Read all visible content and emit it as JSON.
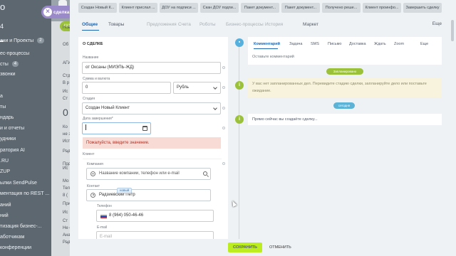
{
  "background": {
    "sidebar_logo": "o",
    "sidebar_num": "4",
    "sidebar_items": [
      {
        "label": "ачи и Проекты",
        "count": "2"
      },
      {
        "label": "ес-процессы",
        "count": ""
      },
      {
        "label": "сты",
        "count": "4"
      },
      {
        "label": "звонки",
        "count": ""
      },
      {
        "label": "а",
        "count": ""
      },
      {
        "label": "ты",
        "count": ""
      },
      {
        "label": "ндарь",
        "count": ""
      },
      {
        "label": "и и отчеты",
        "count": ""
      },
      {
        "label": "удники",
        "count": ""
      },
      {
        "label": "ратория AI",
        "count": ""
      },
      {
        "label": ".RU",
        "count": ""
      },
      {
        "label": "ZUP",
        "count": ""
      },
      {
        "label": "ылки SendPulse",
        "count": ""
      },
      {
        "label": "ментация по REST ...",
        "count": ""
      },
      {
        "label": "аний",
        "count": ""
      },
      {
        "label": "ний",
        "count": ""
      },
      {
        "label": "тизация бизнес-...",
        "count": ""
      },
      {
        "label": "аботчикам",
        "count": ""
      },
      {
        "label": "конференции",
        "count": ""
      }
    ],
    "board_pill": "АКЦ",
    "board_texts": [
      "Нов",
      "Об",
      "АГИ",
      "Стд",
      "В р",
      "Ис",
      "Ст",
      "Ко",
      "не з",
      "Ист",
      "Рад",
      "Прд",
      "Ис",
      "Мо",
      "Тел",
      "8 (",
      "При",
      "Ис",
      "Ст",
      "Не с",
      "Ана",
      "Рад"
    ],
    "board_big": "0"
  },
  "slider_label": "сделка",
  "stages": [
    "Создан Новый К...",
    "Клиент прислал ...",
    "ДОУ на подписи ...",
    "Скан ДОУ подпи...",
    "Пакет документ...",
    "Пакет документ...",
    "Получено реше...",
    "Клиент проинфо...",
    "Завершить сделку"
  ],
  "tabs": [
    {
      "label": "Общие",
      "state": "active"
    },
    {
      "label": "Товары",
      "state": "normal"
    },
    {
      "label": "Предложения",
      "state": "dim"
    },
    {
      "label": "Счета",
      "state": "dim"
    },
    {
      "label": "Роботы",
      "state": "dim"
    },
    {
      "label": "Бизнес-процессы",
      "state": "dim"
    },
    {
      "label": "История",
      "state": "dim"
    },
    {
      "label": "Маркет",
      "state": "normal"
    }
  ],
  "tabs_more": "Еще",
  "form": {
    "header": "О СДЕЛКЕ",
    "title_label": "Название",
    "title_value": "от Оксаны (МИЭПЬ-ЖД)",
    "sum_label": "Сумма и валюта",
    "sum_value": "0",
    "currency_value": "Рубль",
    "stage_label": "Стадия",
    "stage_value": "Создан Новый Клиент",
    "close_date_label": "Дата завершения*",
    "close_date_value": "",
    "error_text": "Пожалуйста, введите значение.",
    "client_label": "Клиент",
    "company_label": "Компания",
    "company_placeholder": "Название компании, телефон или e-mail",
    "contact_label": "Контакт",
    "contact_badge": "новый",
    "contact_value": "Радзиевский Петр",
    "phone_label": "Телефон",
    "phone_value": "8 (964) 050-46-46",
    "email_label": "E-mail",
    "email_placeholder": "E-mail"
  },
  "timeline": {
    "comment_tabs": [
      "Комментарий",
      "Задача",
      "SMS",
      "Письмо",
      "Доставка",
      "Ждать",
      "Zoom"
    ],
    "comment_more": "Еще",
    "comment_placeholder": "Оставьте комментарий",
    "planned_pill": "Запланировано",
    "planned_text": "У вас нет запланированных дел. Перевидите стадию сделки, запланируйте дело или поставьте ожидание.",
    "today_pill": "сегодня",
    "created_text": "Прямо сейчас вы создаёте сделку..."
  },
  "buttons": {
    "save": "СОХРАНИТЬ",
    "cancel": "ОТМЕНИТЬ"
  },
  "colors": {
    "accent": "#2066b0",
    "save_green": "#bbed21",
    "planned_green": "#9bc13b",
    "today_blue": "#5cb3d6",
    "error_bg": "#f9dbd6"
  }
}
